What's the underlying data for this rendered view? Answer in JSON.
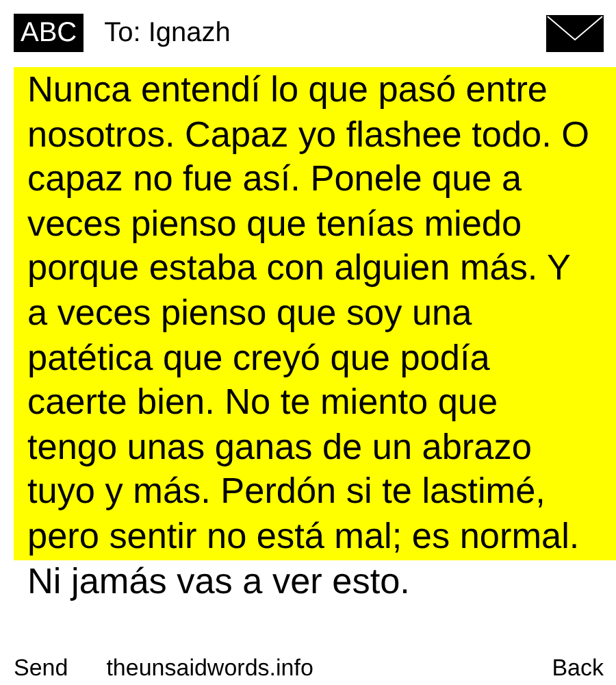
{
  "header": {
    "input_mode": "ABC",
    "recipient": "To: Ignazh"
  },
  "message": {
    "text": "Nunca entendí lo que pasó entre nosotros. Capaz yo flashee todo. O capaz no fue así. Ponele que a veces pienso que tenías miedo porque estaba con alguien más. Y a veces pienso que soy una patética que creyó que podía caerte bien. No te miento que tengo unas ganas de un abrazo tuyo y más. Perdón si te lastimé, pero sentir no está mal; es normal. Ni jamás vas a ver esto."
  },
  "softkeys": {
    "left": "Send",
    "center": "theunsaidwords.info",
    "right": "Back"
  }
}
